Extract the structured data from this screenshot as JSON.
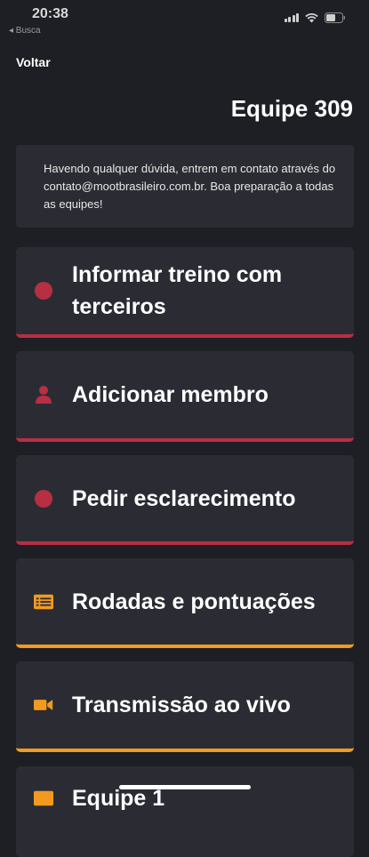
{
  "status_bar": {
    "time": "20:38",
    "back_app": "◂ Busca"
  },
  "nav": {
    "back_label": "Voltar"
  },
  "header": {
    "title": "Equipe 309"
  },
  "info": {
    "text": "Havendo qualquer dúvida, entrem em contato através do contato@mootbrasileiro.com.br. Boa preparação a todas as equipes!"
  },
  "menu": {
    "items": [
      {
        "label": "Informar treino com terceiros",
        "icon": "circle-icon",
        "accent": "#b72f43"
      },
      {
        "label": "Adicionar membro",
        "icon": "person-icon",
        "accent": "#b72f43"
      },
      {
        "label": "Pedir esclarecimento",
        "icon": "circle-icon",
        "accent": "#b72f43"
      },
      {
        "label": "Rodadas e pontuações",
        "icon": "list-icon",
        "accent": "#f29a1f"
      },
      {
        "label": "Transmissão ao vivo",
        "icon": "video-camera-icon",
        "accent": "#f29a1f"
      },
      {
        "label": "Equipe 1",
        "icon": "list-icon",
        "accent": "#f29a1f"
      }
    ]
  },
  "colors": {
    "background": "#1e1f24",
    "card": "#2b2c33",
    "red_accent": "#b72f43",
    "orange_accent": "#f29a1f"
  }
}
